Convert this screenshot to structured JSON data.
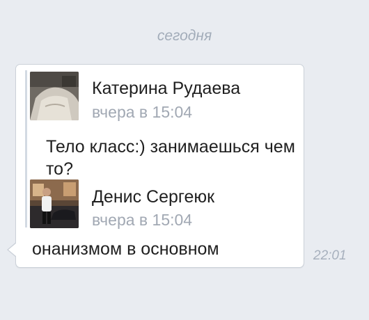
{
  "date_divider": "сегодня",
  "message": {
    "forwarded": [
      {
        "author": "Катерина Рудаева",
        "time": "вчера в 15:04",
        "text": "Тело класс:) занимаешься чем то?"
      },
      {
        "author": "Денис Сергеюк",
        "time": "вчера в 15:04"
      }
    ],
    "text": "онанизмом в основном",
    "time": "22:01"
  },
  "colors": {
    "background": "#e9ecf1",
    "bubble": "#ffffff",
    "bubble_border": "#cbd1d9",
    "forward_bar": "#d3dae3",
    "meta_text": "#a1a8b3"
  }
}
